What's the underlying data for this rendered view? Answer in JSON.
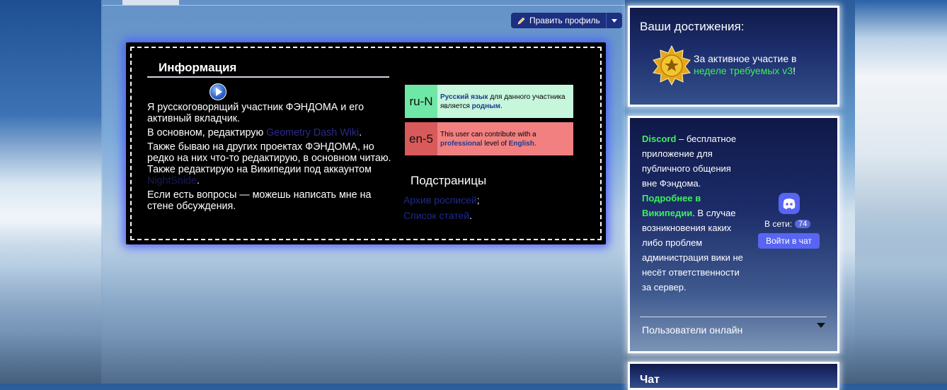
{
  "toolbar": {
    "edit_profile_label": "Править профиль"
  },
  "info": {
    "title": "Информация",
    "p1": "Я русскоговорящий участник ФЭНДОМА и его активный вкладчик.",
    "p2_prefix": "В основном, редактирую ",
    "p2_link": "Geometry Dash Wiki",
    "p2_suffix": ".",
    "p3_text": "Также бываю на других проектах ФЭНДОМА, но редко на них что-то редактирую, в основном читаю. Также редактирую на Википедии под аккаунтом ",
    "p3_link": "NightSnide",
    "p3_suffix": ".",
    "p4": "Если есть вопросы — можешь написать мне на стене обсуждения."
  },
  "userboxes": {
    "ru": {
      "code": "ru-N",
      "lang": "Русский язык",
      "mid": " для данного участника является ",
      "level": "родным",
      "end": "."
    },
    "en": {
      "code": "en-5",
      "pre": "This user can contribute with a ",
      "level": "professional",
      "mid": " level of ",
      "lang": "English",
      "end": "."
    }
  },
  "subpages": {
    "title": "Подстраницы",
    "item1": "Архив росписей",
    "item1_sep": ";",
    "item2": "Список статей",
    "item2_sep": "."
  },
  "achievements": {
    "header": "Ваши достижения:",
    "text": "За активное участие в ",
    "highlight": "неделе требуемых v3",
    "end": "!"
  },
  "discord": {
    "name": "Discord",
    "desc": " – бесплатное приложение для публичного общения вне Фэндома. ",
    "more_link": "Подробнее в Википедии",
    "disclaimer": ". В случае возникновения каких либо проблем администрация вики не несёт ответственности за сервер.",
    "online_label": "В сети:",
    "online_count": "74",
    "join_label": "Войти в чат",
    "users_online": "Пользователи онлайн"
  },
  "chat": {
    "header": "Чат"
  }
}
